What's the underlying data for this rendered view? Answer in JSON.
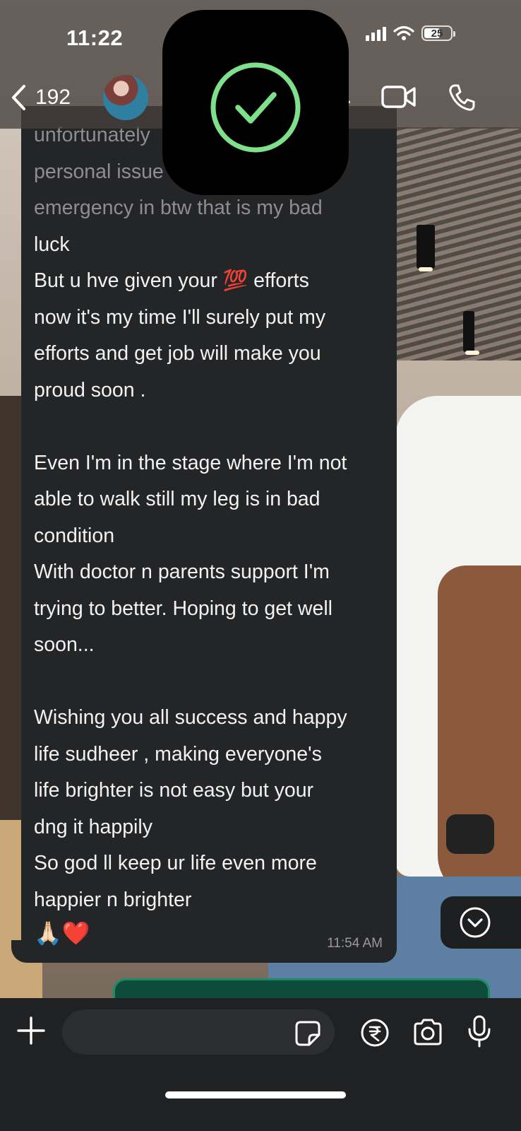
{
  "status_bar": {
    "time": "11:22",
    "battery_level": "25",
    "battery_fraction": 0.25,
    "icons": [
      "cellular-signal-icon",
      "wifi-icon",
      "battery-icon"
    ]
  },
  "header": {
    "back_count": "192",
    "more_indicator": ".",
    "icons": [
      "chevron-left-icon",
      "video-call-icon",
      "phone-icon"
    ]
  },
  "overlay": {
    "icon": "checkmark-circle-icon",
    "accent_color": "#7ee08a"
  },
  "message": {
    "faded_lines": "unfortunately\npersonal issue\nemergency in btw that is my bad",
    "body_before_emoji": "\nluck\nBut u hve given your ",
    "inline_emoji": "💯",
    "body_after_emoji": " efforts\nnow it's my time I'll surely put my\nefforts and get job will make you\nproud soon .\n\nEven I'm in the stage where I'm not\nable to walk still my leg is in bad\ncondition\nWith doctor n parents support I'm\ntrying to better. Hoping to get well\nsoon...\n\nWishing you all success and happy\nlife sudheer , making everyone's\nlife brighter is not easy but your\ndng it happily\nSo god ll keep ur life even more\nhappier n brighter",
    "closing_emoji": "🙏🏻❤️",
    "time": "11:54 AM",
    "bubble_color": "#242527"
  },
  "composer": {
    "icons": [
      "plus-icon",
      "sticker-icon",
      "rupee-payment-icon",
      "camera-icon",
      "microphone-icon"
    ]
  },
  "colors": {
    "outgoing_bubble": "#0f4b3a",
    "outgoing_border": "#1e8a62"
  }
}
